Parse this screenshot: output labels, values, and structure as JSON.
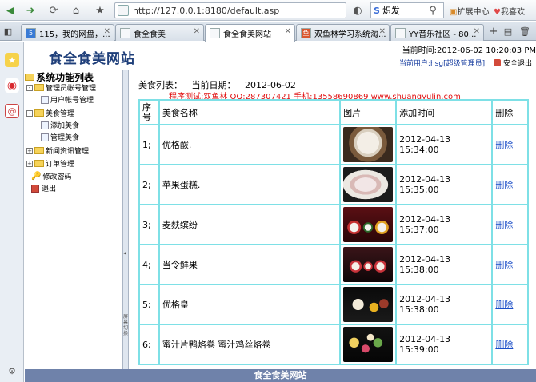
{
  "browser": {
    "url": "http://127.0.0.1:8180/default.asp",
    "search_value": "炽发",
    "ext_center": "扩展中心",
    "love_label": "我喜欢",
    "tabs": [
      {
        "label": "115，我的网盘，...",
        "active": false
      },
      {
        "label": "食全食美",
        "active": false
      },
      {
        "label": "食全食美网站",
        "active": true
      },
      {
        "label": "双鱼林学习系统淘...",
        "active": false
      },
      {
        "label": "YY音乐社区 - 80...",
        "active": false
      }
    ]
  },
  "header": {
    "site_title": "食全食美网站",
    "time_label": "当前时间:",
    "time_value": "2012-06-02 10:20:03 PM",
    "user_label": "当前用户:",
    "user_value": "hsg[超级管理员]",
    "logout": "安全退出"
  },
  "nav": {
    "title": "系统功能列表",
    "items": [
      {
        "label": "管理员帐号管理",
        "level": 1,
        "type": "folder"
      },
      {
        "label": "用户帐号管理",
        "level": 2,
        "type": "leaf"
      },
      {
        "label": "美食管理",
        "level": 1,
        "type": "folder"
      },
      {
        "label": "添加美食",
        "level": 2,
        "type": "leaf"
      },
      {
        "label": "管理美食",
        "level": 2,
        "type": "leaf"
      },
      {
        "label": "新闻资讯管理",
        "level": 1,
        "type": "folder"
      },
      {
        "label": "订单管理",
        "level": 1,
        "type": "folder"
      },
      {
        "label": "修改密码",
        "level": 1,
        "type": "key"
      },
      {
        "label": "退出",
        "level": 1,
        "type": "exit"
      }
    ],
    "splitter_text": "屏幕切换"
  },
  "main": {
    "list_label": "美食列表：",
    "date_label": "当前日期：",
    "date_value": "2012-06-02",
    "tester": "程序测试:双鱼林 QQ:287307421 手机:13558690869 www.shuangyulin.com",
    "columns": [
      "序号",
      "美食名称",
      "图片",
      "添加时间",
      "删除"
    ],
    "rows": [
      {
        "no": "1;",
        "name": "优格酦.",
        "time": "2012-04-13 15:34:00",
        "del": "删除",
        "img": "dessert-bowl"
      },
      {
        "no": "2;",
        "name": "苹果蛋糕.",
        "time": "2012-04-13 15:35:00",
        "del": "删除",
        "img": "cake-plate"
      },
      {
        "no": "3;",
        "name": "麦麸缤纷",
        "time": "2012-04-13 15:37:00",
        "del": "删除",
        "img": "sushi-rolls"
      },
      {
        "no": "4;",
        "name": "当令鲜果",
        "time": "2012-04-13 15:38:00",
        "del": "删除",
        "img": "fruit-cups"
      },
      {
        "no": "5;",
        "name": "优格皇",
        "time": "2012-04-13 15:38:00",
        "del": "删除",
        "img": "yogurt-fruits"
      },
      {
        "no": "6;",
        "name": "蜜汁片鸭烙卷 蜜汁鸡丝烙卷",
        "time": "2012-04-13 15:39:00",
        "del": "删除",
        "img": "macarons"
      }
    ]
  },
  "footer": "食全食美网站"
}
